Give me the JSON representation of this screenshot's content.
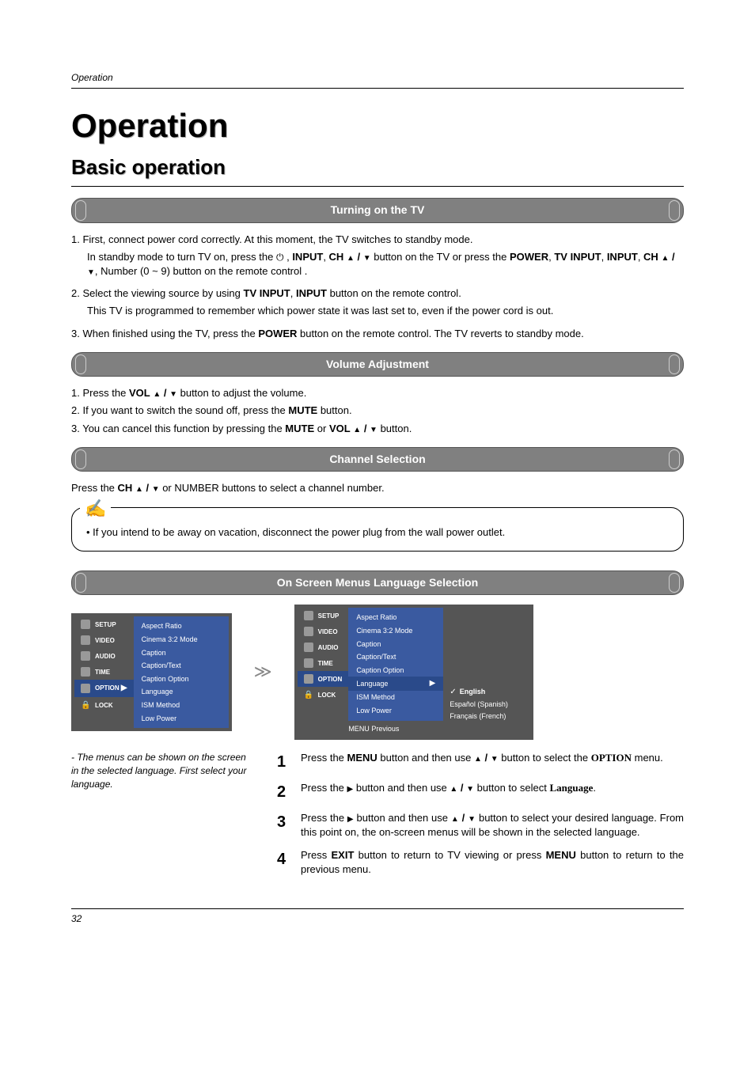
{
  "runningHead": "Operation",
  "chapterTitle": "Operation",
  "sectionTitle": "Basic operation",
  "headings": {
    "turnOn": "Turning on the TV",
    "volume": "Volume Adjustment",
    "channel": "Channel Selection",
    "osdLang": "On Screen Menus Language Selection"
  },
  "turnOn": {
    "l1": "1. First, connect power cord correctly. At this moment, the TV switches to standby mode.",
    "l1a_pre": "In standby mode to turn TV on, press the ",
    "l1a_mid1": ", ",
    "input": "INPUT",
    "l1a_mid2": ", ",
    "ch": "CH",
    "l1a_mid3": " button on the TV or press the ",
    "power": "POWER",
    "l1a_mid4": ", ",
    "tvinput": "TV INPUT",
    "l1a_mid5": ", ",
    "l1a_tail": ", Number (0 ~ 9) button on the remote control .",
    "l2a": "2. Select the viewing source by using ",
    "l2b": " button on the remote control.",
    "l2c": "This TV is programmed to remember which power state it was last set to, even if the power cord is out.",
    "l3a": "3. When finished using the TV, press the ",
    "l3b": " button on the remote control. The TV reverts to  standby mode."
  },
  "volume": {
    "l1a": "1. Press the ",
    "vol": "VOL",
    "l1b": " button to adjust the volume.",
    "l2a": "2. If you want to switch the sound off, press the ",
    "mute": "MUTE",
    "l2b": " button.",
    "l3a": "3. You can cancel this function by pressing the ",
    "l3b": " or ",
    "l3c": " button."
  },
  "channel": {
    "l1a": "Press the ",
    "ch": "CH",
    "l1b": " or NUMBER buttons to select a channel number."
  },
  "note": "• If you intend to be away on vacation, disconnect the power plug from the wall power outlet.",
  "osd": {
    "nav": [
      "SETUP",
      "VIDEO",
      "AUDIO",
      "TIME",
      "OPTION",
      "LOCK"
    ],
    "optionSel": "OPTION",
    "items": [
      "Aspect Ratio",
      "Cinema 3:2 Mode",
      "Caption",
      "Caption/Text",
      "Caption Option",
      "Language",
      "ISM Method",
      "Low Power"
    ],
    "langs": [
      "English",
      "Español (Spanish)",
      "Français (French)"
    ],
    "footMenu": "MENU",
    "footPrev": "Previous"
  },
  "hint": "- The menus can be shown on the screen in the selected language. First select your language.",
  "steps": {
    "s1a": "Press the ",
    "menu": "MENU",
    "s1b": " button and then use ",
    "s1c": " button to select the ",
    "option": "OPTION",
    "s1d": " menu.",
    "s2a": "Press the ",
    "s2b": " button and then use ",
    "s2c": " button to select ",
    "language": "Language",
    "s2d": ".",
    "s3a": "Press the ",
    "s3b": " button and then use ",
    "s3c": " button to select your desired language. From this point on, the on-screen menus will be shown in the selected language.",
    "s4a": "Press ",
    "exit": "EXIT",
    "s4b": " button to return to TV viewing or press ",
    "s4c": " button to return to the previous menu."
  },
  "pageNumber": "32",
  "slashSep": " / "
}
